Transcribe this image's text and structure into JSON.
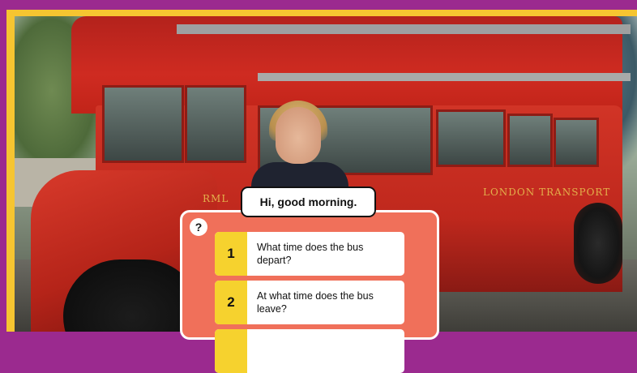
{
  "speech": {
    "text": "Hi, good morning."
  },
  "panel": {
    "help_label": "?",
    "options": [
      {
        "number": "1",
        "text": "What time does the bus depart?"
      },
      {
        "number": "2",
        "text": "At what time does the bus leave?"
      },
      {
        "number": "",
        "text": ""
      }
    ]
  },
  "scene": {
    "bus_plate": "RML",
    "bus_fleet_text": "LONDON TRANSPORT"
  },
  "colors": {
    "frame": "#9b2a8f",
    "border": "#f6c531",
    "panel": "#f0705a",
    "number_tab": "#f6d22e"
  }
}
